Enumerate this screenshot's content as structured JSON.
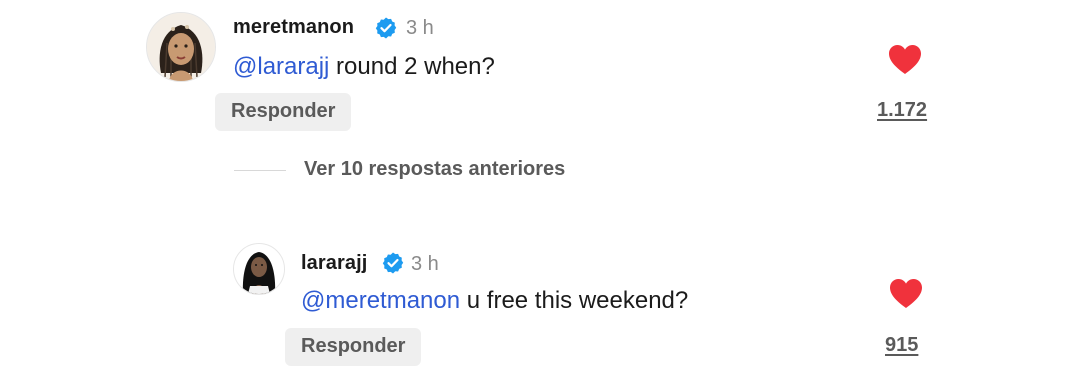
{
  "comments": [
    {
      "username": "meretmanon",
      "time": "3 h",
      "mention": "@lararajj",
      "text": " round 2 when?",
      "reply_label": "Responder",
      "likes": "1.172",
      "verified": true,
      "avatar_icon": "profile-photo-icon"
    },
    {
      "username": "lararajj",
      "time": "3 h",
      "mention": "@meretmanon",
      "text": " u free this weekend?",
      "reply_label": "Responder",
      "likes": "915",
      "verified": true,
      "avatar_icon": "profile-photo-icon"
    }
  ],
  "thread": {
    "view_more_label": "Ver 10 respostas anteriores"
  },
  "colors": {
    "heart": "#f0323c",
    "mention": "#2f5bd3",
    "verified": "#1d9bf0"
  }
}
